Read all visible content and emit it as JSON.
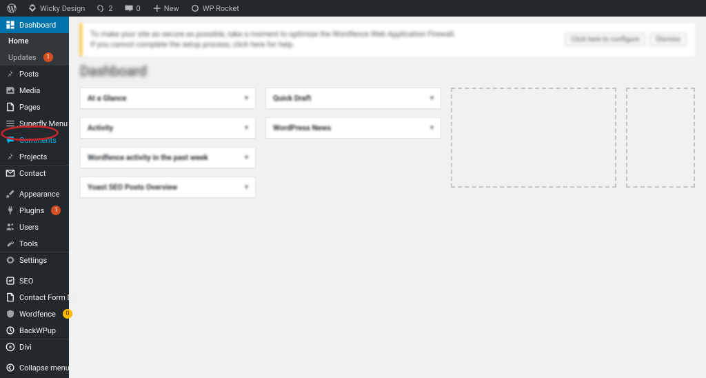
{
  "adminbar": {
    "site_name": "Wicky Design",
    "updates": "2",
    "comments": "0",
    "new": "New",
    "extras": [
      "WP Rocket"
    ]
  },
  "sidebar": {
    "items": [
      {
        "id": "dashboard",
        "label": "Dashboard",
        "icon": "dashboard",
        "current": true
      },
      {
        "id": "home",
        "label": "Home",
        "sub": true,
        "active": true
      },
      {
        "id": "updates",
        "label": "Updates",
        "sub": true,
        "badge": "1"
      },
      {
        "id": "posts",
        "label": "Posts",
        "icon": "pin"
      },
      {
        "id": "media",
        "label": "Media",
        "icon": "media"
      },
      {
        "id": "pages",
        "label": "Pages",
        "icon": "page"
      },
      {
        "id": "superfly",
        "label": "Superfly Menu",
        "icon": "menu"
      },
      {
        "id": "comments",
        "label": "Comments",
        "icon": "comment",
        "highlighted": true
      },
      {
        "id": "projects",
        "label": "Projects",
        "icon": "pin"
      },
      {
        "id": "contact",
        "label": "Contact",
        "icon": "mail",
        "sepAfter": true
      },
      {
        "id": "appearance",
        "label": "Appearance",
        "icon": "brush"
      },
      {
        "id": "plugins",
        "label": "Plugins",
        "icon": "plug",
        "badge": "1"
      },
      {
        "id": "users",
        "label": "Users",
        "icon": "users"
      },
      {
        "id": "tools",
        "label": "Tools",
        "icon": "wrench"
      },
      {
        "id": "settings",
        "label": "Settings",
        "icon": "gear",
        "sepAfter": true
      },
      {
        "id": "seo",
        "label": "SEO",
        "icon": "seo"
      },
      {
        "id": "cfdb",
        "label": "Contact Form DB",
        "icon": "page"
      },
      {
        "id": "wordfence",
        "label": "Wordfence",
        "icon": "shield",
        "badge": "0",
        "badgeColor": "yellow"
      },
      {
        "id": "backwpup",
        "label": "BackWPup",
        "icon": "backup"
      },
      {
        "id": "divi",
        "label": "Divi",
        "icon": "divi",
        "sepAfter": true
      },
      {
        "id": "collapse",
        "label": "Collapse menu",
        "icon": "collapse"
      }
    ]
  },
  "notice": {
    "text": "To make your site as secure as possible, take a moment to optimize the Wordfence Web Application Firewall.",
    "subtext": "If you cannot complete the setup process, click here for help.",
    "btn_configure": "Click here to configure",
    "btn_dismiss": "Dismiss"
  },
  "page_title": "Dashboard",
  "postboxes": {
    "col1": [
      {
        "title": "At a Glance"
      },
      {
        "title": "Activity"
      },
      {
        "title": "Wordfence activity in the past week"
      },
      {
        "title": "Yoast SEO Posts Overview"
      }
    ],
    "col2": [
      {
        "title": "Quick Draft"
      },
      {
        "title": "WordPress News"
      }
    ]
  }
}
